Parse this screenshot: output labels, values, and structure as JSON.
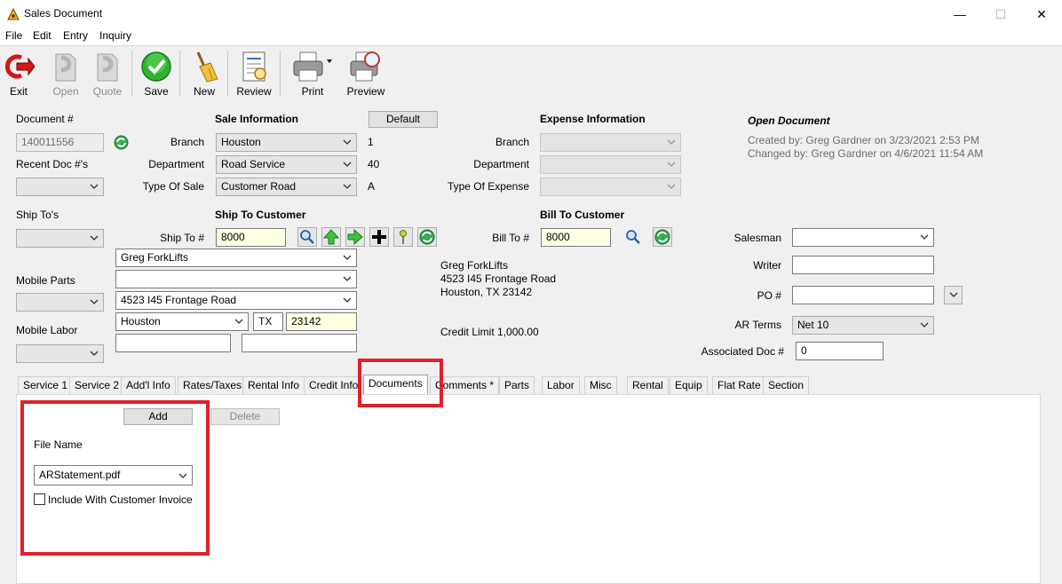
{
  "window": {
    "title": "Sales Document",
    "minimize": "—",
    "maximize": "☐",
    "close": "✕"
  },
  "menu": [
    "File",
    "Edit",
    "Entry",
    "Inquiry"
  ],
  "toolbar": [
    {
      "label": "Exit",
      "icon": "exit-icon",
      "enabled": true
    },
    {
      "label": "Open",
      "icon": "open-icon",
      "enabled": false
    },
    {
      "label": "Quote",
      "icon": "quote-icon",
      "enabled": false
    },
    {
      "label": "Save",
      "icon": "save-check-icon",
      "enabled": true
    },
    {
      "label": "New",
      "icon": "broom-icon",
      "enabled": true
    },
    {
      "label": "Review",
      "icon": "review-icon",
      "enabled": true
    },
    {
      "label": "Print",
      "icon": "printer-icon",
      "enabled": true
    },
    {
      "label": "Preview",
      "icon": "print-preview-icon",
      "enabled": true
    }
  ],
  "document": {
    "label": "Document #",
    "number": "140011556",
    "recent_label": "Recent Doc #'s",
    "ship_tos_label": "Ship To's",
    "mobile_parts_label": "Mobile Parts",
    "mobile_labor_label": "Mobile Labor"
  },
  "sale_info": {
    "heading": "Sale Information",
    "default_button": "Default",
    "branch_label": "Branch",
    "branch_value": "Houston",
    "branch_code": "1",
    "department_label": "Department",
    "department_value": "Road Service",
    "department_code": "40",
    "type_label": "Type Of Sale",
    "type_value": "Customer Road",
    "type_code": "A"
  },
  "expense_info": {
    "heading": "Expense Information",
    "branch_label": "Branch",
    "department_label": "Department",
    "type_label": "Type Of Expense"
  },
  "status": {
    "heading": "Open Document",
    "created": "Created by: Greg Gardner on 3/23/2021 2:53 PM",
    "changed": "Changed by: Greg Gardner on 4/6/2021 11:54 AM"
  },
  "ship_to": {
    "heading": "Ship To Customer",
    "ship_to_label": "Ship To #",
    "ship_to_value": "8000",
    "name": "Greg ForkLifts",
    "address2": "",
    "address1": "4523 I45 Frontage Road",
    "city": "Houston",
    "state": "TX",
    "zip": "23142",
    "extra1": "",
    "extra2": ""
  },
  "bill_to": {
    "heading": "Bill To Customer",
    "bill_to_label": "Bill To #",
    "bill_to_value": "8000",
    "name": "Greg ForkLifts",
    "address": "4523 I45 Frontage Road",
    "city_line": "Houston, TX  23142",
    "credit_limit": "Credit Limit 1,000.00"
  },
  "right_fields": {
    "salesman_label": "Salesman",
    "salesman_value": "",
    "writer_label": "Writer",
    "writer_value": "",
    "po_label": "PO #",
    "po_value": "",
    "ar_terms_label": "AR Terms",
    "ar_terms_value": "Net 10",
    "assoc_label": "Associated Doc #",
    "assoc_value": "0"
  },
  "tabs": [
    "Service 1",
    "Service 2",
    "Add'l Info",
    "Rates/Taxes",
    "Rental Info",
    "Credit Info",
    "Documents",
    "Comments *",
    "Parts",
    "Labor",
    "Misc",
    "Rental",
    "Equip",
    "Flat Rate",
    "Section"
  ],
  "active_tab": "Documents",
  "documents_panel": {
    "add_button": "Add",
    "delete_button": "Delete",
    "file_name_label": "File Name",
    "file_name_value": "ARStatement.pdf",
    "include_label": "Include With Customer Invoice",
    "include_checked": false
  },
  "colors": {
    "highlight_red": "#e0202a",
    "input_yellow": "#ffffe1",
    "form_bg": "#f0f0f0"
  }
}
